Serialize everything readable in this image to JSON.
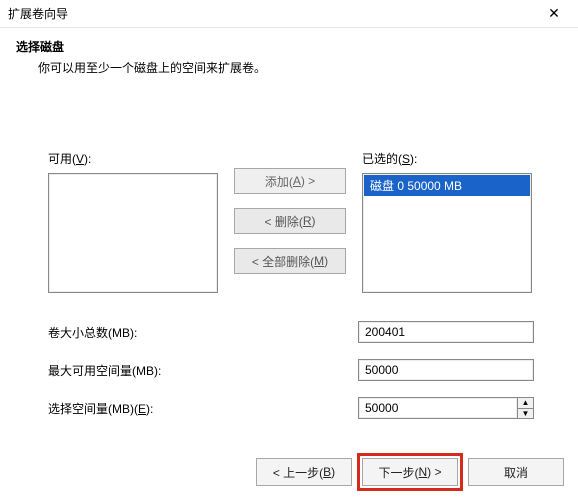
{
  "window": {
    "title": "扩展卷向导",
    "close_glyph": "✕"
  },
  "header": {
    "step_title": "选择磁盘",
    "step_desc": "你可以用至少一个磁盘上的空间来扩展卷。"
  },
  "lists": {
    "available_label_pre": "可用(",
    "available_label_u": "V",
    "available_label_post": "):",
    "selected_label_pre": "已选的(",
    "selected_label_u": "S",
    "selected_label_post": "):",
    "available_items": [],
    "selected_items": [
      {
        "text": "磁盘 0    50000 MB",
        "selected": true
      }
    ]
  },
  "buttons": {
    "add_pre": "添加(",
    "add_u": "A",
    "add_post": ") >",
    "remove_pre": "< 删除(",
    "remove_u": "R",
    "remove_post": ")",
    "remove_all_pre": "< 全部删除(",
    "remove_all_u": "M",
    "remove_all_post": ")"
  },
  "fields": {
    "total_label": "卷大小总数(MB):",
    "total_value": "200401",
    "max_label": "最大可用空间量(MB):",
    "max_value": "50000",
    "amount_label_pre": "选择空间量(MB)(",
    "amount_label_u": "E",
    "amount_label_post": "):",
    "amount_value": "50000"
  },
  "footer": {
    "back_pre": "< 上一步(",
    "back_u": "B",
    "back_post": ")",
    "next_pre": "下一步(",
    "next_u": "N",
    "next_post": ") >",
    "cancel": "取消"
  },
  "glyphs": {
    "up": "▲",
    "down": "▼"
  }
}
